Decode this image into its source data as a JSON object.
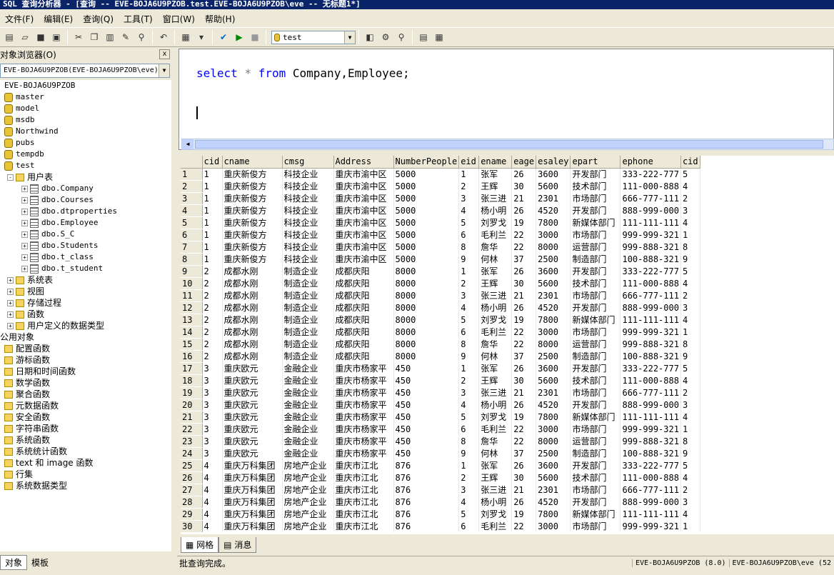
{
  "window": {
    "title": "SQL 查询分析器 - [查询 -- EVE-BOJA6U9PZOB.test.EVE-BOJA6U9PZOB\\eve -- 无标题1*]"
  },
  "menu": [
    "文件(F)",
    "编辑(E)",
    "查询(Q)",
    "工具(T)",
    "窗口(W)",
    "帮助(H)"
  ],
  "toolbar": {
    "database": "test"
  },
  "object_browser": {
    "title": "对象浏览器(O)",
    "server_combo": "EVE-BOJA6U9PZOB(EVE-BOJA6U9PZOB\\eve)",
    "close": "x",
    "tree": [
      {
        "label": "EVE-BOJA6U9PZOB",
        "depth": 0,
        "icon": "server-icon",
        "expander": ""
      },
      {
        "label": "master",
        "depth": 0,
        "icon": "database-icon",
        "expander": ""
      },
      {
        "label": "model",
        "depth": 0,
        "icon": "database-icon",
        "expander": ""
      },
      {
        "label": "msdb",
        "depth": 0,
        "icon": "database-icon",
        "expander": ""
      },
      {
        "label": "Northwind",
        "depth": 0,
        "icon": "database-icon",
        "expander": ""
      },
      {
        "label": "pubs",
        "depth": 0,
        "icon": "database-icon",
        "expander": ""
      },
      {
        "label": "tempdb",
        "depth": 0,
        "icon": "database-icon",
        "expander": ""
      },
      {
        "label": "test",
        "depth": 0,
        "icon": "database-icon",
        "expander": ""
      },
      {
        "label": "用户表",
        "depth": 1,
        "icon": "folder-icon",
        "expander": "-"
      },
      {
        "label": "dbo.Company",
        "depth": 2,
        "icon": "table-icon",
        "expander": "+"
      },
      {
        "label": "dbo.Courses",
        "depth": 2,
        "icon": "table-icon",
        "expander": "+"
      },
      {
        "label": "dbo.dtproperties",
        "depth": 2,
        "icon": "table-icon",
        "expander": "+"
      },
      {
        "label": "dbo.Employee",
        "depth": 2,
        "icon": "table-icon",
        "expander": "+"
      },
      {
        "label": "dbo.S_C",
        "depth": 2,
        "icon": "table-icon",
        "expander": "+"
      },
      {
        "label": "dbo.Students",
        "depth": 2,
        "icon": "table-icon",
        "expander": "+"
      },
      {
        "label": "dbo.t_class",
        "depth": 2,
        "icon": "table-icon",
        "expander": "+"
      },
      {
        "label": "dbo.t_student",
        "depth": 2,
        "icon": "table-icon",
        "expander": "+"
      },
      {
        "label": "系统表",
        "depth": 1,
        "icon": "folder-icon",
        "expander": "+"
      },
      {
        "label": "视图",
        "depth": 1,
        "icon": "folder-icon",
        "expander": "+"
      },
      {
        "label": "存储过程",
        "depth": 1,
        "icon": "folder-icon",
        "expander": "+"
      },
      {
        "label": "函数",
        "depth": 1,
        "icon": "folder-icon",
        "expander": "+"
      },
      {
        "label": "用户定义的数据类型",
        "depth": 1,
        "icon": "folder-icon",
        "expander": "+"
      },
      {
        "label": "公用对象",
        "depth": -1,
        "icon": "",
        "expander": ""
      },
      {
        "label": "配置函数",
        "depth": 0,
        "icon": "folder-icon",
        "expander": ""
      },
      {
        "label": "游标函数",
        "depth": 0,
        "icon": "folder-icon",
        "expander": ""
      },
      {
        "label": "日期和时间函数",
        "depth": 0,
        "icon": "folder-icon",
        "expander": ""
      },
      {
        "label": "数学函数",
        "depth": 0,
        "icon": "folder-icon",
        "expander": ""
      },
      {
        "label": "聚合函数",
        "depth": 0,
        "icon": "folder-icon",
        "expander": ""
      },
      {
        "label": "元数据函数",
        "depth": 0,
        "icon": "folder-icon",
        "expander": ""
      },
      {
        "label": "安全函数",
        "depth": 0,
        "icon": "folder-icon",
        "expander": ""
      },
      {
        "label": "字符串函数",
        "depth": 0,
        "icon": "folder-icon",
        "expander": ""
      },
      {
        "label": "系统函数",
        "depth": 0,
        "icon": "folder-icon",
        "expander": ""
      },
      {
        "label": "系统统计函数",
        "depth": 0,
        "icon": "folder-icon",
        "expander": ""
      },
      {
        "label": "text 和 image 函数",
        "depth": 0,
        "icon": "folder-icon",
        "expander": ""
      },
      {
        "label": "行集",
        "depth": 0,
        "icon": "folder-icon",
        "expander": ""
      },
      {
        "label": "系统数据类型",
        "depth": 0,
        "icon": "folder-icon",
        "expander": ""
      }
    ],
    "tabs": [
      "对象",
      "模板"
    ]
  },
  "editor": {
    "sql": {
      "kw1": "select",
      "star": "*",
      "kw2": "from",
      "rest": "Company,Employee;"
    }
  },
  "results": {
    "columns": [
      "cid",
      "cname",
      "cmsg",
      "Address",
      "NumberPeople",
      "eid",
      "ename",
      "eage",
      "esaley",
      "epart",
      "ephone",
      "cid"
    ],
    "col_widths": [
      28,
      84,
      72,
      84,
      90,
      28,
      46,
      32,
      48,
      70,
      82,
      26
    ],
    "companies": [
      {
        "cid": "1",
        "cname": "重庆新俊方",
        "cmsg": "科技企业",
        "address": "重庆市渝中区",
        "num": "5000"
      },
      {
        "cid": "2",
        "cname": "成都水刚",
        "cmsg": "制造企业",
        "address": "成都庆阳",
        "num": "8000"
      },
      {
        "cid": "3",
        "cname": "重庆欧元",
        "cmsg": "金融企业",
        "address": "重庆市杨家平",
        "num": "450"
      },
      {
        "cid": "4",
        "cname": "重庆万科集团",
        "cmsg": "房地产企业",
        "address": "重庆市江北",
        "num": "876"
      }
    ],
    "employees": [
      {
        "eid": "1",
        "ename": "张军",
        "eage": "26",
        "esaley": "3600",
        "epart": "开发部门",
        "ephone": "333-222-777",
        "cid": "5"
      },
      {
        "eid": "2",
        "ename": "王辉",
        "eage": "30",
        "esaley": "5600",
        "epart": "技术部门",
        "ephone": "111-000-888",
        "cid": "4"
      },
      {
        "eid": "3",
        "ename": "张三进",
        "eage": "21",
        "esaley": "2301",
        "epart": "市场部门",
        "ephone": "666-777-111",
        "cid": "2"
      },
      {
        "eid": "4",
        "ename": "杨小明",
        "eage": "26",
        "esaley": "4520",
        "epart": "开发部门",
        "ephone": "888-999-000",
        "cid": "3"
      },
      {
        "eid": "5",
        "ename": "刘罗戈",
        "eage": "19",
        "esaley": "7800",
        "epart": "新媒体部门",
        "ephone": "111-111-111",
        "cid": "4"
      },
      {
        "eid": "6",
        "ename": "毛利兰",
        "eage": "22",
        "esaley": "3000",
        "epart": "市场部门",
        "ephone": "999-999-321",
        "cid": "1"
      },
      {
        "eid": "8",
        "ename": "詹华",
        "eage": "22",
        "esaley": "8000",
        "epart": "运营部门",
        "ephone": "999-888-321",
        "cid": "8"
      },
      {
        "eid": "9",
        "ename": "何林",
        "eage": "37",
        "esaley": "2500",
        "epart": "制造部门",
        "ephone": "100-888-321",
        "cid": "9"
      }
    ],
    "visible_rows": 30,
    "tabs": [
      "网格",
      "消息"
    ]
  },
  "status": {
    "message": "批查询完成。",
    "server": "EVE-BOJA6U9PZOB (8.0)",
    "user": "EVE-BOJA6U9PZOB\\eve (52"
  }
}
